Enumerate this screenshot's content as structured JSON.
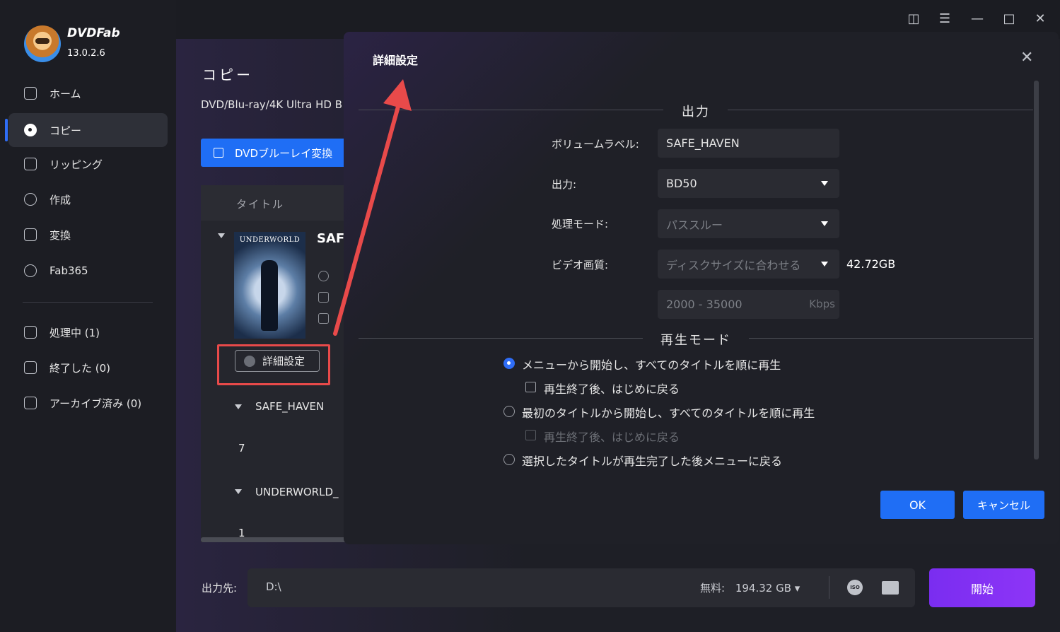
{
  "app": {
    "name": "DVDFab",
    "version": "13.0.2.6"
  },
  "sidebar": {
    "items": [
      {
        "label": "ホーム",
        "icon": "home-icon"
      },
      {
        "label": "コピー",
        "icon": "copy-disc-icon",
        "active": true
      },
      {
        "label": "リッピング",
        "icon": "ripper-icon"
      },
      {
        "label": "作成",
        "icon": "creator-icon"
      },
      {
        "label": "変換",
        "icon": "converter-icon"
      },
      {
        "label": "Fab365",
        "icon": "fab365-icon"
      }
    ],
    "tasks": [
      {
        "label": "処理中 (1)",
        "icon": "processing-icon"
      },
      {
        "label": "終了した (0)",
        "icon": "finished-icon"
      },
      {
        "label": "アーカイブ済み (0)",
        "icon": "archive-icon"
      }
    ]
  },
  "main": {
    "title": "コピー",
    "subtitle": "DVD/Blu-ray/4K Ultra HD B",
    "mode_button": "DVDブルーレイ変換",
    "list_header": "タイトル",
    "movie_title": "SAF",
    "poster_text": "UNDERWORLD",
    "advanced_button": "詳細設定",
    "tree": [
      {
        "label": "SAFE_HAVEN"
      },
      {
        "label": "7"
      },
      {
        "label": "UNDERWORLD_"
      },
      {
        "label": "1"
      }
    ]
  },
  "output": {
    "label": "出力先:",
    "path": "D:\\",
    "free_label": "無料:",
    "free_value": "194.32 GB",
    "start_button": "開始"
  },
  "dialog": {
    "title": "詳細設定",
    "section_output": "出力",
    "volume_label": {
      "label": "ボリュームラベル:",
      "value": "SAFE_HAVEN"
    },
    "output": {
      "label": "出力:",
      "value": "BD50"
    },
    "process_mode": {
      "label": "処理モード:",
      "value": "パススルー"
    },
    "video_quality": {
      "label": "ビデオ画質:",
      "value": "ディスクサイズに合わせる",
      "size": "42.72GB"
    },
    "bitrate": {
      "value": "2000 - 35000",
      "unit": "Kbps"
    },
    "section_playback": "再生モード",
    "playback_options": [
      {
        "label": "メニューから開始し、すべてのタイトルを順に再生",
        "selected": true
      },
      {
        "label": "再生終了後、はじめに戻る",
        "type": "checkbox",
        "checked": false
      },
      {
        "label": "最初のタイトルから開始し、すべてのタイトルを順に再生",
        "selected": false
      },
      {
        "label": "再生終了後、はじめに戻る",
        "type": "checkbox",
        "checked": false,
        "disabled": true
      },
      {
        "label": "選択したタイトルが再生完了した後メニューに戻る",
        "selected": false
      }
    ],
    "ok_button": "OK",
    "cancel_button": "キャンセル"
  },
  "colors": {
    "accent": "#1f6ef5",
    "start": "#7a2df0",
    "highlight": "#e84a4a"
  }
}
